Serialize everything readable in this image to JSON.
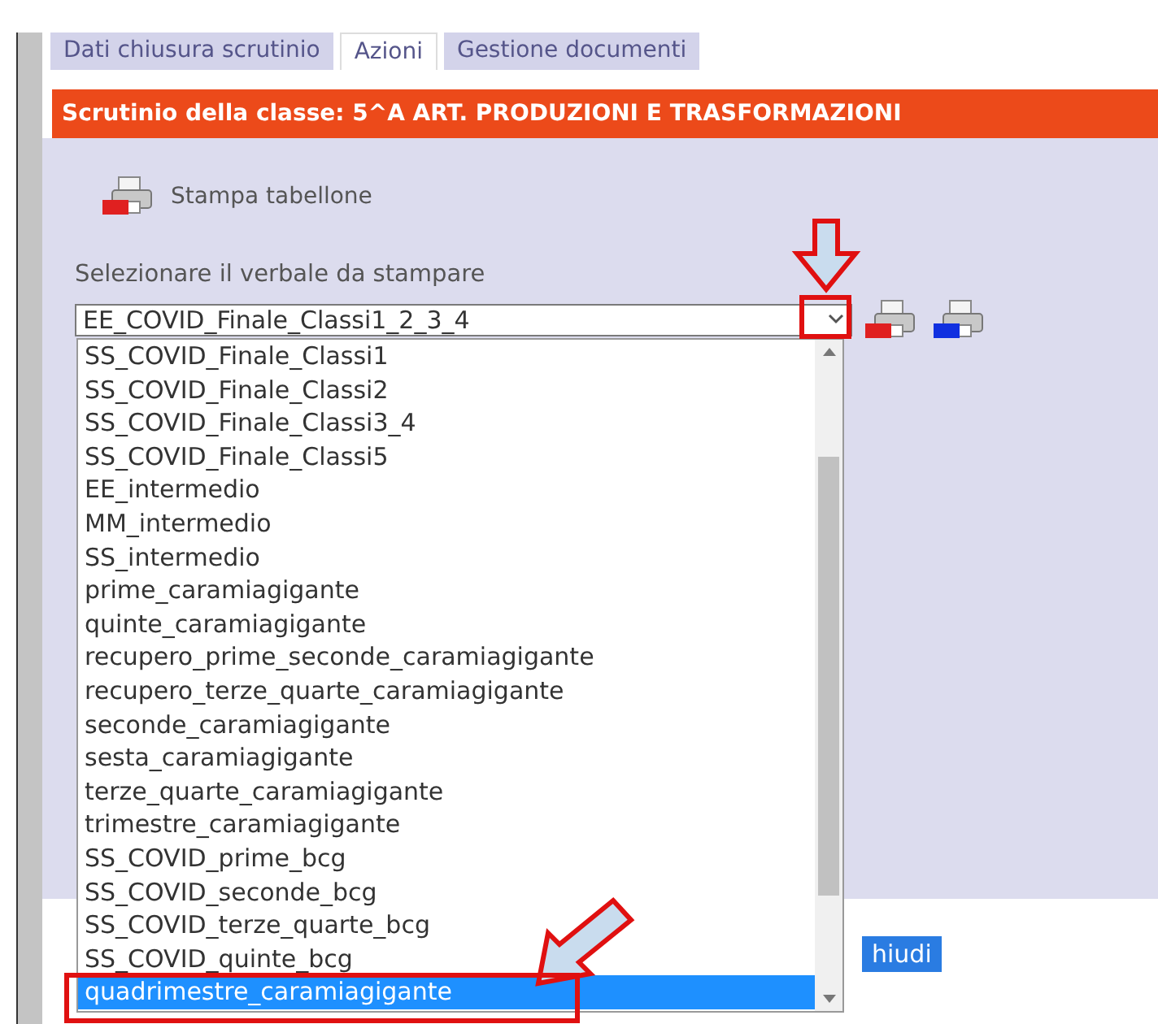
{
  "tabs": [
    {
      "label": "Dati chiusura scrutinio",
      "selected": false
    },
    {
      "label": "Azioni",
      "selected": true
    },
    {
      "label": "Gestione documenti",
      "selected": false
    }
  ],
  "class_header": "Scrutinio della classe: 5^A ART. PRODUZIONI E TRASFORMAZIONI",
  "print_board": {
    "label": "Stampa tabellone"
  },
  "report_select": {
    "label": "Selezionare il verbale da stampare",
    "value": "EE_COVID_Finale_Classi1_2_3_4",
    "expanded": true,
    "options": [
      {
        "label": "SS_COVID_Finale_Classi1",
        "selected": false
      },
      {
        "label": "SS_COVID_Finale_Classi2",
        "selected": false
      },
      {
        "label": "SS_COVID_Finale_Classi3_4",
        "selected": false
      },
      {
        "label": "SS_COVID_Finale_Classi5",
        "selected": false
      },
      {
        "label": "EE_intermedio",
        "selected": false
      },
      {
        "label": "MM_intermedio",
        "selected": false
      },
      {
        "label": "SS_intermedio",
        "selected": false
      },
      {
        "label": "prime_caramiagigante",
        "selected": false
      },
      {
        "label": "quinte_caramiagigante",
        "selected": false
      },
      {
        "label": "recupero_prime_seconde_caramiagigante",
        "selected": false
      },
      {
        "label": "recupero_terze_quarte_caramiagigante",
        "selected": false
      },
      {
        "label": "seconde_caramiagigante",
        "selected": false
      },
      {
        "label": "sesta_caramiagigante",
        "selected": false
      },
      {
        "label": "terze_quarte_caramiagigante",
        "selected": false
      },
      {
        "label": "trimestre_caramiagigante",
        "selected": false
      },
      {
        "label": "SS_COVID_prime_bcg",
        "selected": false
      },
      {
        "label": "SS_COVID_seconde_bcg",
        "selected": false
      },
      {
        "label": "SS_COVID_terze_quarte_bcg",
        "selected": false
      },
      {
        "label": "SS_COVID_quinte_bcg",
        "selected": false
      },
      {
        "label": "quadrimestre_caramiagigante",
        "selected": true
      }
    ]
  },
  "close_button": {
    "label": "hiudi"
  }
}
